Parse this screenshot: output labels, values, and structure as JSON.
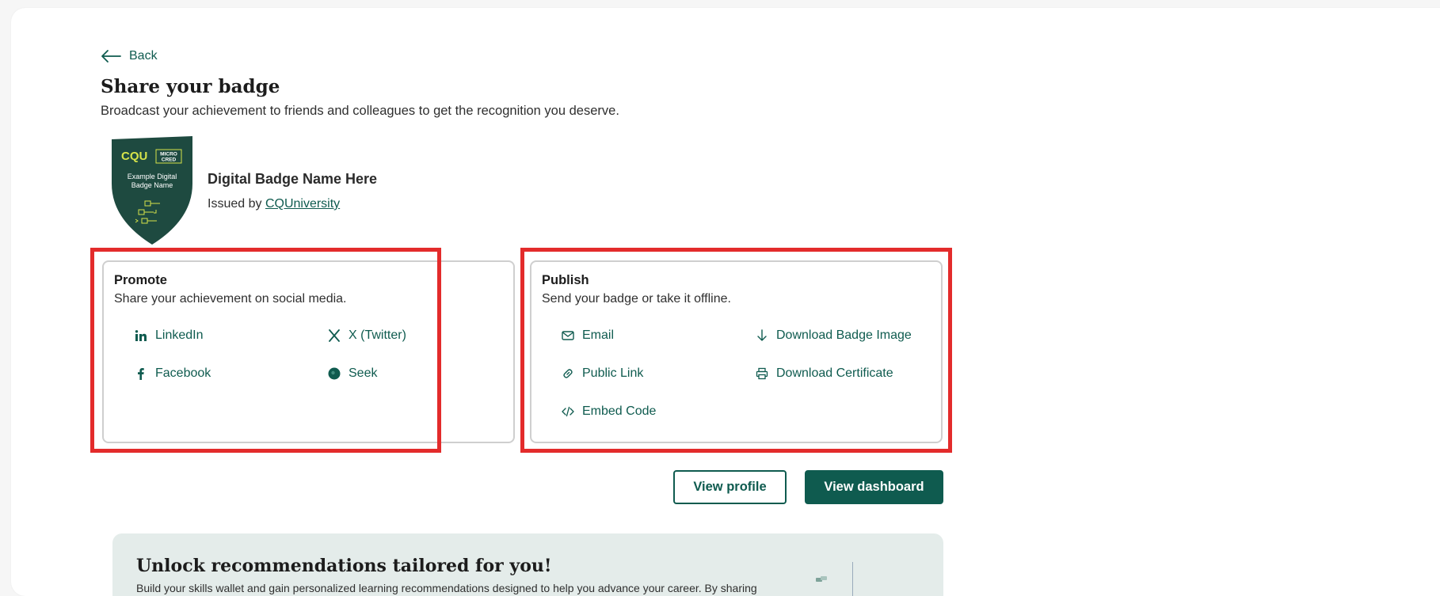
{
  "nav": {
    "back_label": "Back"
  },
  "header": {
    "title": "Share your badge",
    "subtitle": "Broadcast your achievement to friends and colleagues to get the recognition you deserve."
  },
  "badge": {
    "logo_text": "CQU",
    "micro_line1": "MICRO",
    "micro_line2": "CRED",
    "graphic_line1": "Example Digital",
    "graphic_line2": "Badge Name",
    "name": "Digital Badge Name Here",
    "issued_prefix": "Issued by",
    "issuer": "CQUniversity",
    "colors": {
      "shield": "#1e4a40",
      "accent": "#d6e34a"
    }
  },
  "promote": {
    "title": "Promote",
    "description": "Share your achievement on social media.",
    "items": [
      {
        "label": "LinkedIn",
        "icon": "linkedin-icon"
      },
      {
        "label": "X (Twitter)",
        "icon": "x-twitter-icon"
      },
      {
        "label": "Facebook",
        "icon": "facebook-icon"
      },
      {
        "label": "Seek",
        "icon": "seek-icon"
      }
    ]
  },
  "publish": {
    "title": "Publish",
    "description": "Send your badge or take it offline.",
    "items": [
      {
        "label": "Email",
        "icon": "envelope-icon"
      },
      {
        "label": "Download Badge Image",
        "icon": "download-icon"
      },
      {
        "label": "Public Link",
        "icon": "link-icon"
      },
      {
        "label": "Download Certificate",
        "icon": "printer-icon"
      },
      {
        "label": "Embed Code",
        "icon": "code-icon"
      }
    ]
  },
  "actions": {
    "view_profile": "View profile",
    "view_dashboard": "View dashboard"
  },
  "promo": {
    "title": "Unlock recommendations tailored for you!",
    "text": "Build your skills wallet and gain personalized learning recommendations designed to help you advance your career. By sharing"
  },
  "colors": {
    "primary": "#0f5b4f",
    "highlight": "#e32b2b"
  }
}
